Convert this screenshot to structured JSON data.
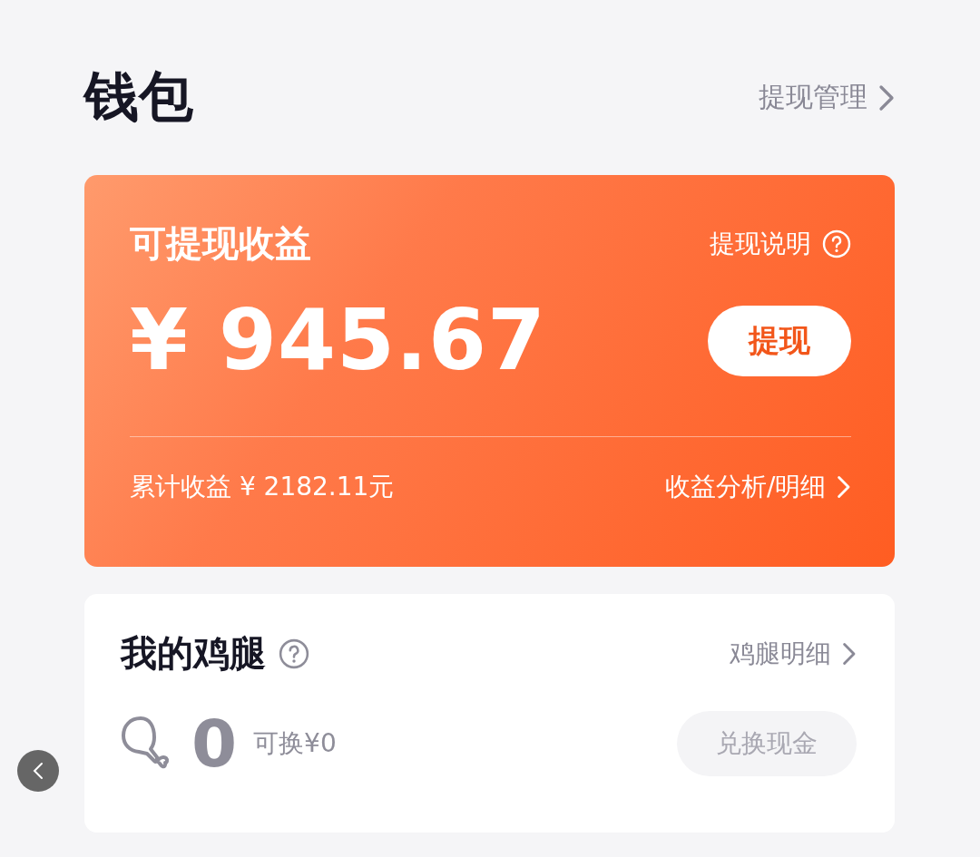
{
  "header": {
    "title": "钱包",
    "link": "提现管理"
  },
  "earnings": {
    "title": "可提现收益",
    "help": "提现说明",
    "amount": "¥ 945.67",
    "action": "提现",
    "total": "累计收益 ¥ 2182.11元",
    "details": "收益分析/明细"
  },
  "drumsticks": {
    "title": "我的鸡腿",
    "details": "鸡腿明细",
    "count": "0",
    "exchangeable": "可换¥0",
    "action": {
      "label": "兑换现金",
      "disabled": true
    }
  }
}
